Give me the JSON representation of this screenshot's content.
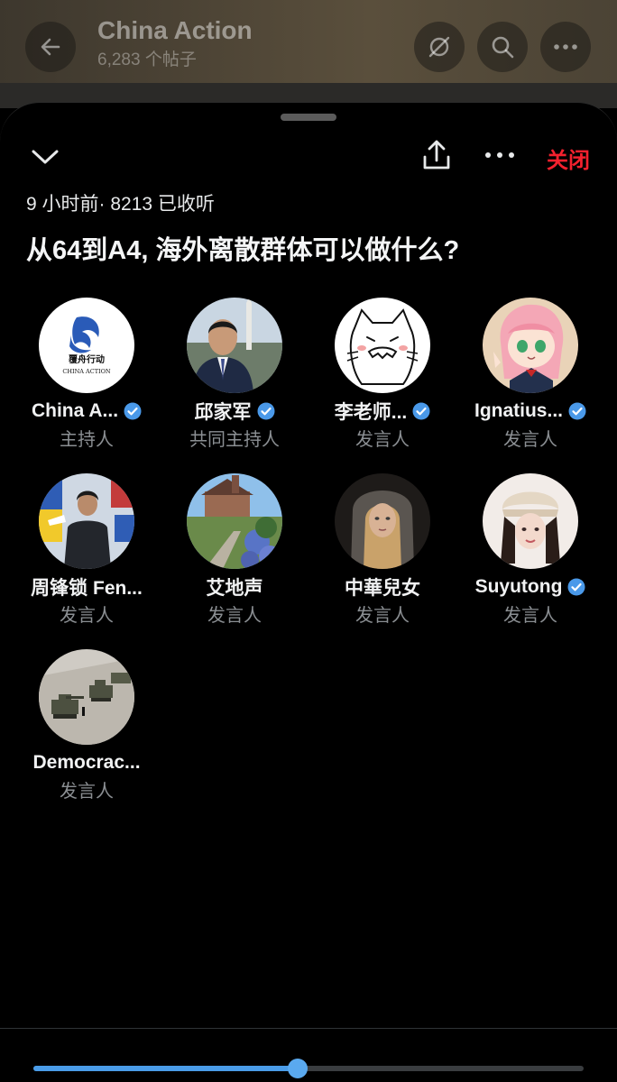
{
  "background_header": {
    "title": "China Action",
    "subtitle": "6,283 个帖子"
  },
  "space": {
    "close_label": "关闭",
    "meta": "9 小时前· 8213 已收听",
    "title": "从64到A4, 海外离散群体可以做什么?",
    "playback_progress": 0.48
  },
  "avatars": {
    "china_action_logo_text": "覆舟行动",
    "china_action_logo_sub": "CHINA ACTION"
  },
  "participants": [
    {
      "name": "China A...",
      "role": "主持人",
      "verified": true
    },
    {
      "name": "邱家军",
      "role": "共同主持人",
      "verified": true
    },
    {
      "name": "李老师...",
      "role": "发言人",
      "verified": true
    },
    {
      "name": "Ignatius...",
      "role": "发言人",
      "verified": true
    },
    {
      "name": "周锋锁 Fen...",
      "role": "发言人",
      "verified": false
    },
    {
      "name": "艾地声",
      "role": "发言人",
      "verified": false
    },
    {
      "name": "中華兒女",
      "role": "发言人",
      "verified": false
    },
    {
      "name": "Suyutong",
      "role": "发言人",
      "verified": true
    },
    {
      "name": "Democrac...",
      "role": "发言人",
      "verified": false
    }
  ],
  "colors": {
    "accent_blue": "#4a9ce8",
    "verified_blue": "#4a99e9",
    "close_red": "#f4212e"
  }
}
